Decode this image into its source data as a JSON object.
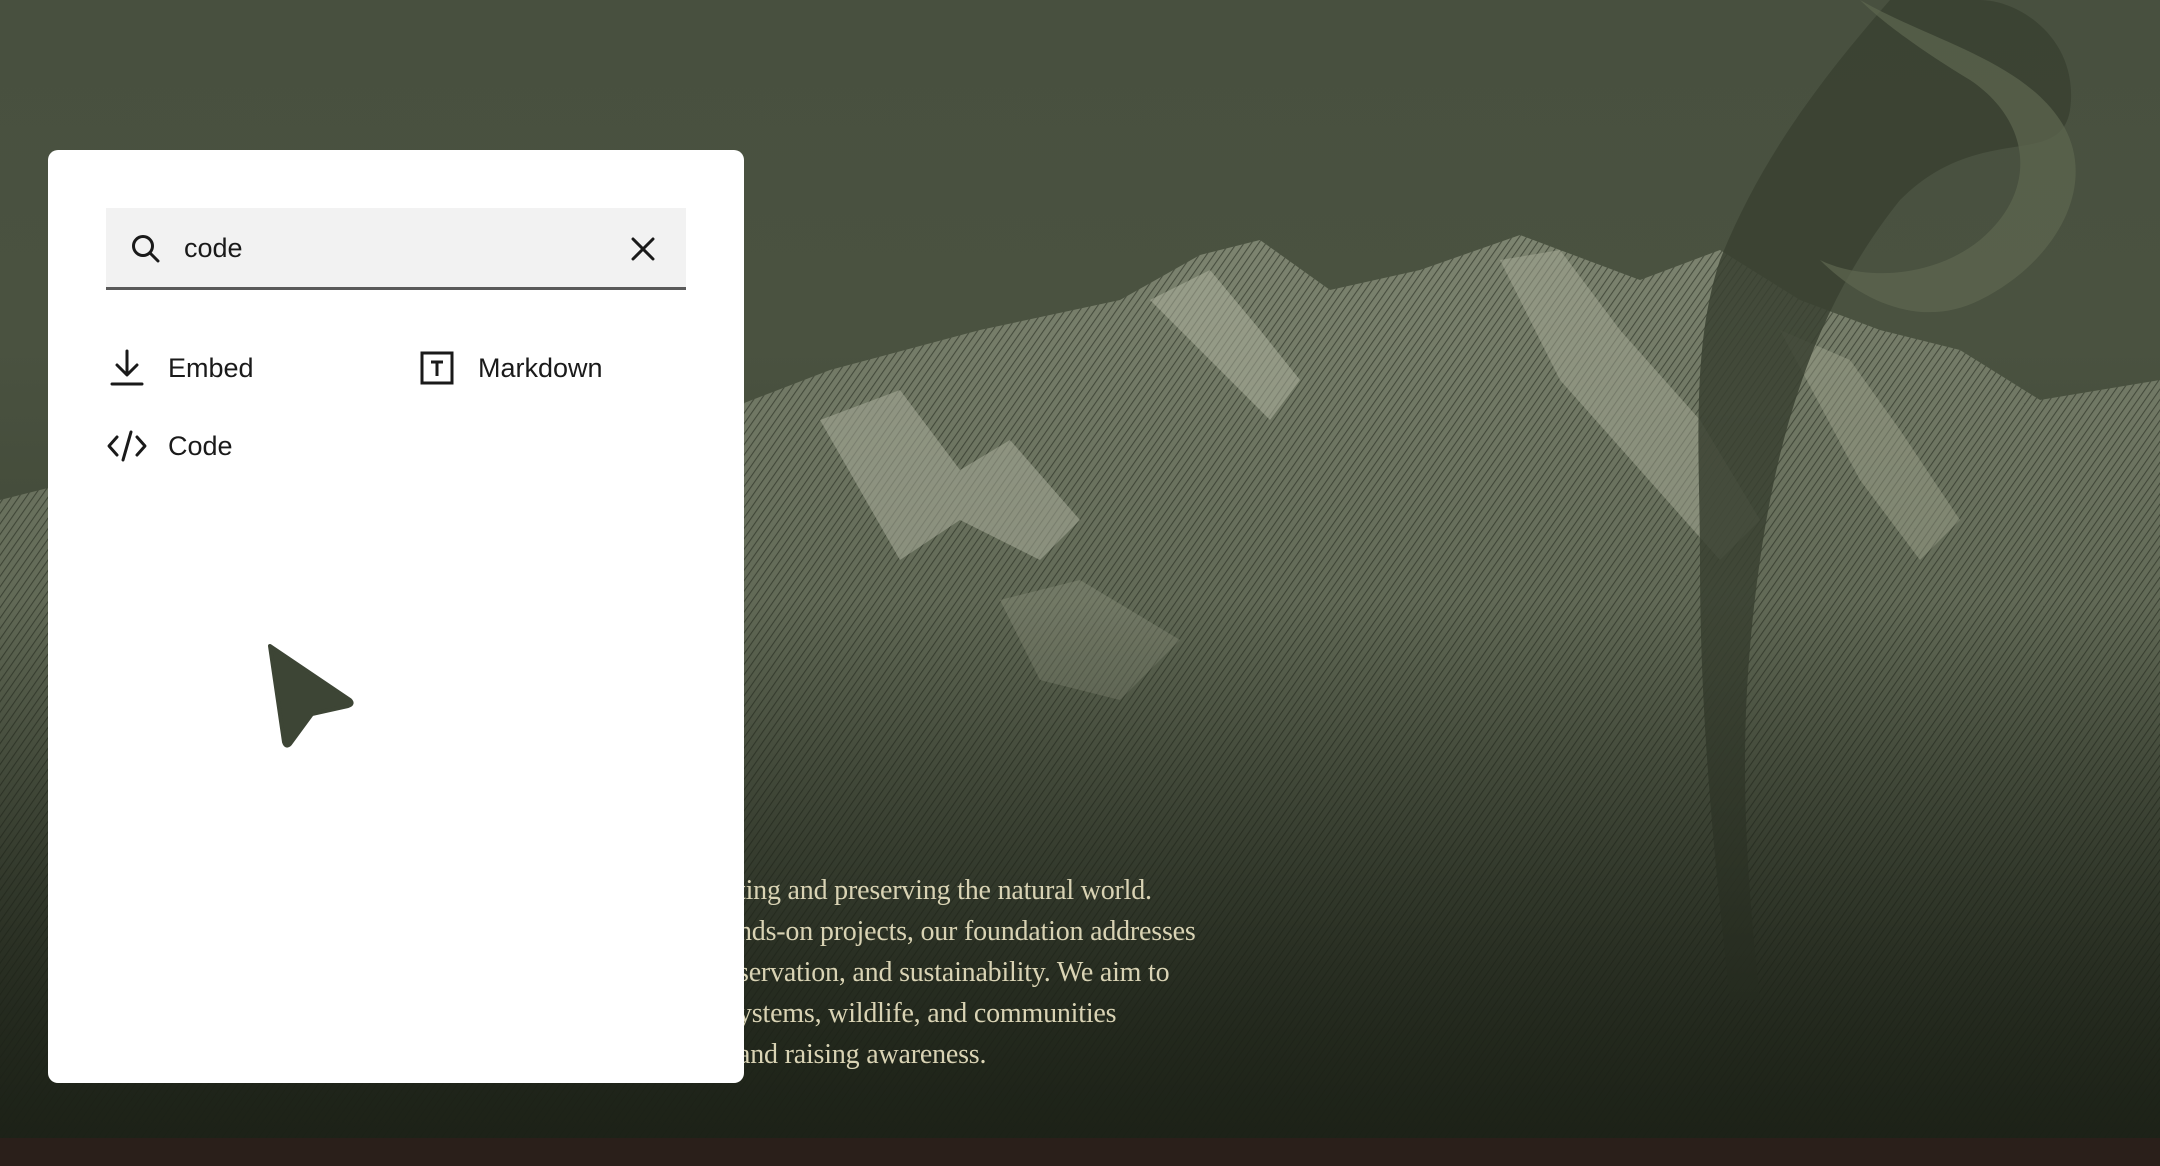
{
  "search": {
    "value": "code",
    "icon": "search-icon",
    "clear_icon": "close-icon"
  },
  "results": [
    {
      "label": "Embed",
      "icon": "download-icon"
    },
    {
      "label": "Markdown",
      "icon": "text-box-icon"
    },
    {
      "label": "Code",
      "icon": "code-icon"
    }
  ],
  "background": {
    "paragraph_lines": [
      "ting and preserving the natural world.",
      "nds-on projects, our foundation addresses",
      "servation, and sustainability. We aim to",
      "ystems, wildlife, and communities",
      "and raising awareness."
    ]
  },
  "colors": {
    "overlay": "#4a5240",
    "panel": "#ffffff",
    "cursor": "#3d4535",
    "bottom_bar": "#2a1f1a"
  }
}
